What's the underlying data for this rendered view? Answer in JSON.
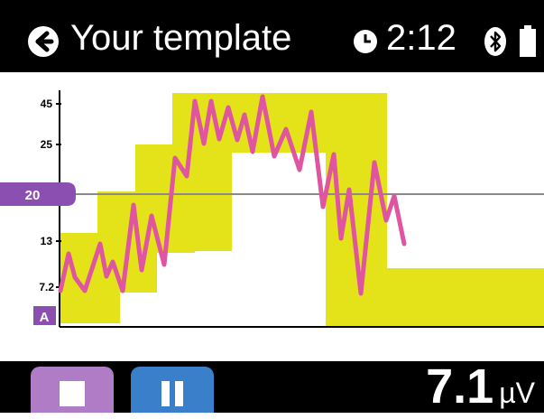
{
  "header": {
    "title": "Your template",
    "time": "2:12",
    "back_icon": "back-arrow-icon",
    "clock_icon": "clock-icon",
    "bluetooth_icon": "bluetooth-icon",
    "battery_icon": "battery-icon"
  },
  "plot": {
    "y_ticks": [
      "45",
      "25",
      "13",
      "7.2"
    ],
    "threshold_label": "20",
    "channel_label": "A",
    "colors": {
      "band": "#e4e31a",
      "signal": "#e0559f",
      "threshold_line": "#8a8a8a",
      "label_bg": "#8b4fb2"
    }
  },
  "footer": {
    "stop_icon": "stop-icon",
    "pause_icon": "pause-icon",
    "reading_value": "7.1",
    "reading_unit": "µV",
    "colors": {
      "stop": "#b07cc6",
      "pause": "#3a7fc9"
    }
  }
}
